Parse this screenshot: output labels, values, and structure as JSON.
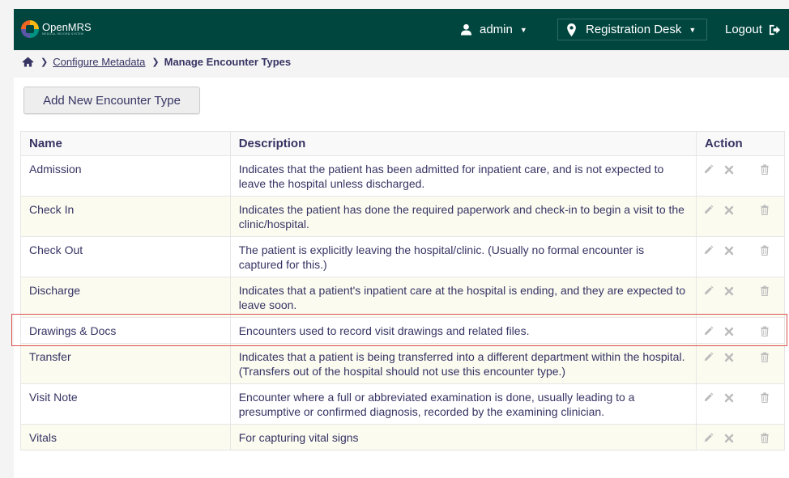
{
  "header": {
    "logo_name": "OpenMRS",
    "logo_subtitle": "MEDICAL RECORD SYSTEM",
    "user_label": "admin",
    "location_label": "Registration Desk",
    "logout_label": "Logout",
    "bg_color": "#00463f"
  },
  "breadcrumb": {
    "home_icon": "home-icon",
    "items": [
      {
        "label": "Configure Metadata ",
        "link": true
      },
      {
        "label": "Manage Encounter Types",
        "link": false
      }
    ]
  },
  "toolbar": {
    "add_button_label": "Add New Encounter Type"
  },
  "table": {
    "columns": [
      "Name",
      "Description",
      "Action"
    ],
    "rows": [
      {
        "name": "Admission",
        "description": "Indicates that the patient has been admitted for inpatient care, and is not expected to leave the hospital unless discharged."
      },
      {
        "name": "Check In",
        "description": "Indicates the patient has done the required paperwork and check-in to begin a visit to the clinic/hospital."
      },
      {
        "name": "Check Out",
        "description": "The patient is explicitly leaving the hospital/clinic. (Usually no formal encounter is captured for this.)"
      },
      {
        "name": "Discharge",
        "description": "Indicates that a patient's inpatient care at the hospital is ending, and they are expected to leave soon."
      },
      {
        "name": "Drawings & Docs",
        "description": "Encounters used to record visit drawings and related files."
      },
      {
        "name": "Transfer",
        "description": "Indicates that a patient is being transferred into a different department within the hospital. (Transfers out of the hospital should not use this encounter type.)"
      },
      {
        "name": "Visit Note",
        "description": "Encounter where a full or abbreviated examination is done, usually leading to a presumptive or confirmed diagnosis, recorded by the examining clinician."
      },
      {
        "name": "Vitals",
        "description": "For capturing vital signs"
      }
    ],
    "action_icons": [
      "pencil-icon",
      "retire-x-icon",
      "trash-icon"
    ],
    "highlighted_row": "Drawings & Docs",
    "highlight_color": "#d9534f"
  }
}
